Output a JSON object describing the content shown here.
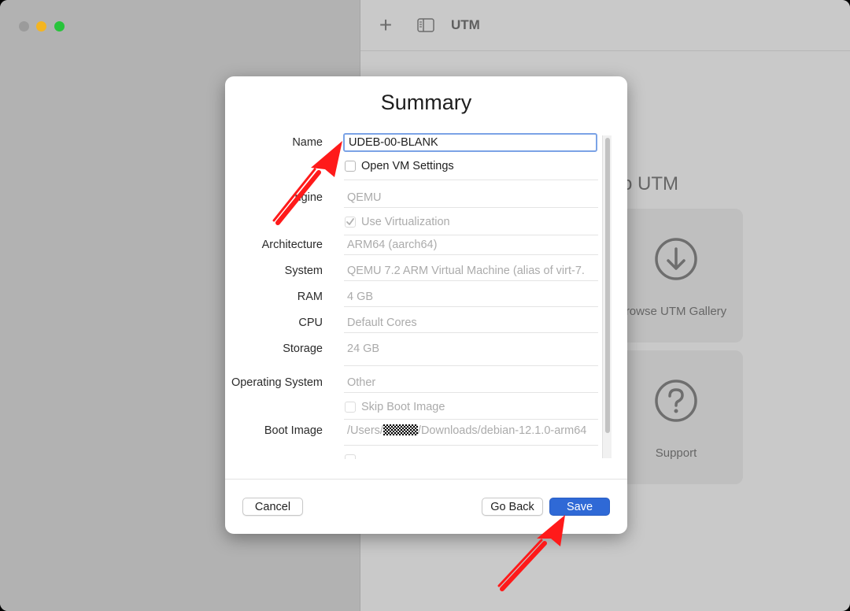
{
  "window": {
    "toolbar_title": "UTM"
  },
  "main": {
    "welcome_text": "o UTM",
    "tiles": [
      {
        "label": "rowse UTM Gallery",
        "icon": "download-circle-icon"
      },
      {
        "label": "Support",
        "icon": "question-circle-icon"
      }
    ]
  },
  "dialog": {
    "title": "Summary",
    "fields": {
      "name_label": "Name",
      "name_value": "UDEB-00-BLANK",
      "open_vm_settings_label": "Open VM Settings",
      "engine_label": "ngine",
      "engine_value": "QEMU",
      "use_virtualization_label": "Use Virtualization",
      "architecture_label": "Architecture",
      "architecture_value": "ARM64 (aarch64)",
      "system_label": "System",
      "system_value": "QEMU 7.2 ARM Virtual Machine (alias of virt-7.",
      "ram_label": "RAM",
      "ram_value": "4 GB",
      "cpu_label": "CPU",
      "cpu_value": "Default Cores",
      "storage_label": "Storage",
      "storage_value": "24 GB",
      "os_label": "Operating System",
      "os_value": "Other",
      "skip_boot_label": "Skip Boot Image",
      "boot_image_label": "Boot Image",
      "boot_image_prefix": "/Users/",
      "boot_image_suffix": "/Downloads/debian-12.1.0-arm64"
    },
    "checkboxes": {
      "open_vm_settings": false,
      "use_virtualization": true,
      "skip_boot_image": false
    },
    "buttons": {
      "cancel": "Cancel",
      "go_back": "Go Back",
      "save": "Save"
    }
  },
  "colors": {
    "accent": "#2f69d6",
    "annotation_arrow": "#ff1a1a",
    "focus_ring": "#7ba3e6"
  }
}
